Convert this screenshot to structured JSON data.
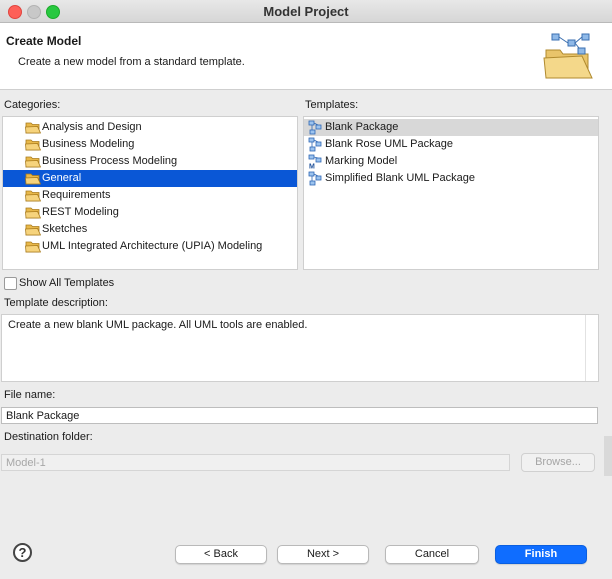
{
  "window": {
    "title": "Model Project"
  },
  "banner": {
    "title": "Create Model",
    "subtitle": "Create a new model from a standard template.",
    "icon": "folder-model-icon"
  },
  "categories": {
    "label": "Categories:",
    "selected_index": 3,
    "items": [
      {
        "label": "Analysis and Design"
      },
      {
        "label": "Business Modeling"
      },
      {
        "label": "Business Process Modeling"
      },
      {
        "label": "General"
      },
      {
        "label": "Requirements"
      },
      {
        "label": "REST Modeling"
      },
      {
        "label": "Sketches"
      },
      {
        "label": "UML Integrated Architecture (UPIA) Modeling"
      }
    ]
  },
  "templates": {
    "label": "Templates:",
    "selected_index": 0,
    "items": [
      {
        "label": "Blank Package",
        "icon": "package-icon"
      },
      {
        "label": "Blank Rose UML Package",
        "icon": "package-icon"
      },
      {
        "label": "Marking Model",
        "icon": "marking-model-icon"
      },
      {
        "label": "Simplified Blank UML Package",
        "icon": "package-icon"
      }
    ]
  },
  "show_all": {
    "label": "Show All Templates",
    "checked": false
  },
  "description": {
    "label": "Template description:",
    "text": "Create a new blank UML package. All UML tools are enabled."
  },
  "file_name": {
    "label": "File name:",
    "value": "Blank Package"
  },
  "destination": {
    "label": "Destination folder:",
    "value": "Model-1",
    "browse_label": "Browse..."
  },
  "buttons": {
    "help_glyph": "?",
    "back": "< Back",
    "next": "Next >",
    "cancel": "Cancel",
    "finish": "Finish"
  },
  "colors": {
    "selection": "#0a57d6",
    "primary": "#0f6dff"
  }
}
